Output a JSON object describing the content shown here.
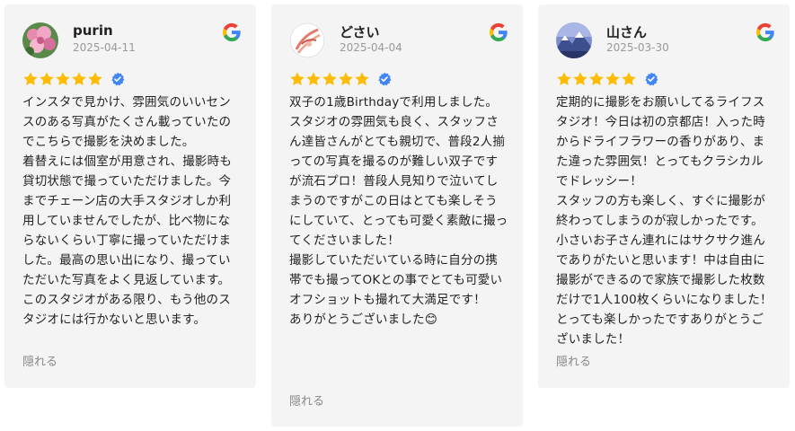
{
  "reviews": [
    {
      "name": "purin",
      "date": "2025-04-11",
      "rating": 5,
      "avatar": "flower-photo-avatar",
      "text": "インスタで見かけ、雰囲気のいいセンスのある写真がたくさん載っていたのでこちらで撮影を決めました。\n着替えには個室が用意され、撮影時も貸切状態で撮っていただけました。今までチェーン店の大手スタジオしか利用していませんでしたが、比べ物にならないくらい丁寧に撮っていただけました。最高の思い出になり、撮っていただいた写真をよく見返しています。このスタジオがある限り、もう他のスタジオには行かないと思います。",
      "more_label": "隠れる"
    },
    {
      "name": "どさい",
      "date": "2025-04-04",
      "rating": 5,
      "avatar": "sketch-avatar",
      "text": "双子の1歳Birthdayで利用しました。\nスタジオの雰囲気も良く、スタッフさん達皆さんがとても親切で、普段2人揃っての写真を撮るのが難しい双子ですが流石プロ！普段人見知りで泣いてしまうのですがこの日はとても楽しそうにしていて、とっても可愛く素敵に撮ってくださいました！\n撮影していただいている時に自分の携帯でも撮ってOKとの事でとても可愛いオフショットも撮れて大満足です！\nありがとうございました😊",
      "more_label": "隠れる"
    },
    {
      "name": "山さん",
      "date": "2025-03-30",
      "rating": 5,
      "avatar": "mountain-avatar",
      "text": "定期的に撮影をお願いしてるライフスタジオ！今日は初の京都店！入った時からドライフラワーの香りがあり、また違った雰囲気！とってもクラシカルでドレッシー！\nスタッフの方も楽しく、すぐに撮影が終わってしまうのが寂しかったです。小さいお子さん連れにはサクサク進んでありがたいと思います！中は自由に撮影ができるので家族で撮影した枚数だけで1人100枚くらいになりました！とっても楽しかったですありがとうございました！",
      "more_label": "隠れる"
    }
  ],
  "colors": {
    "card_bg": "#f4f4f4",
    "star": "#fbbc04",
    "verified": "#4285f4",
    "name": "#222222",
    "date": "#999999",
    "more": "#888888"
  },
  "icons": {
    "source": "google-logo-icon",
    "star": "star-icon",
    "verified": "verified-badge-icon"
  }
}
